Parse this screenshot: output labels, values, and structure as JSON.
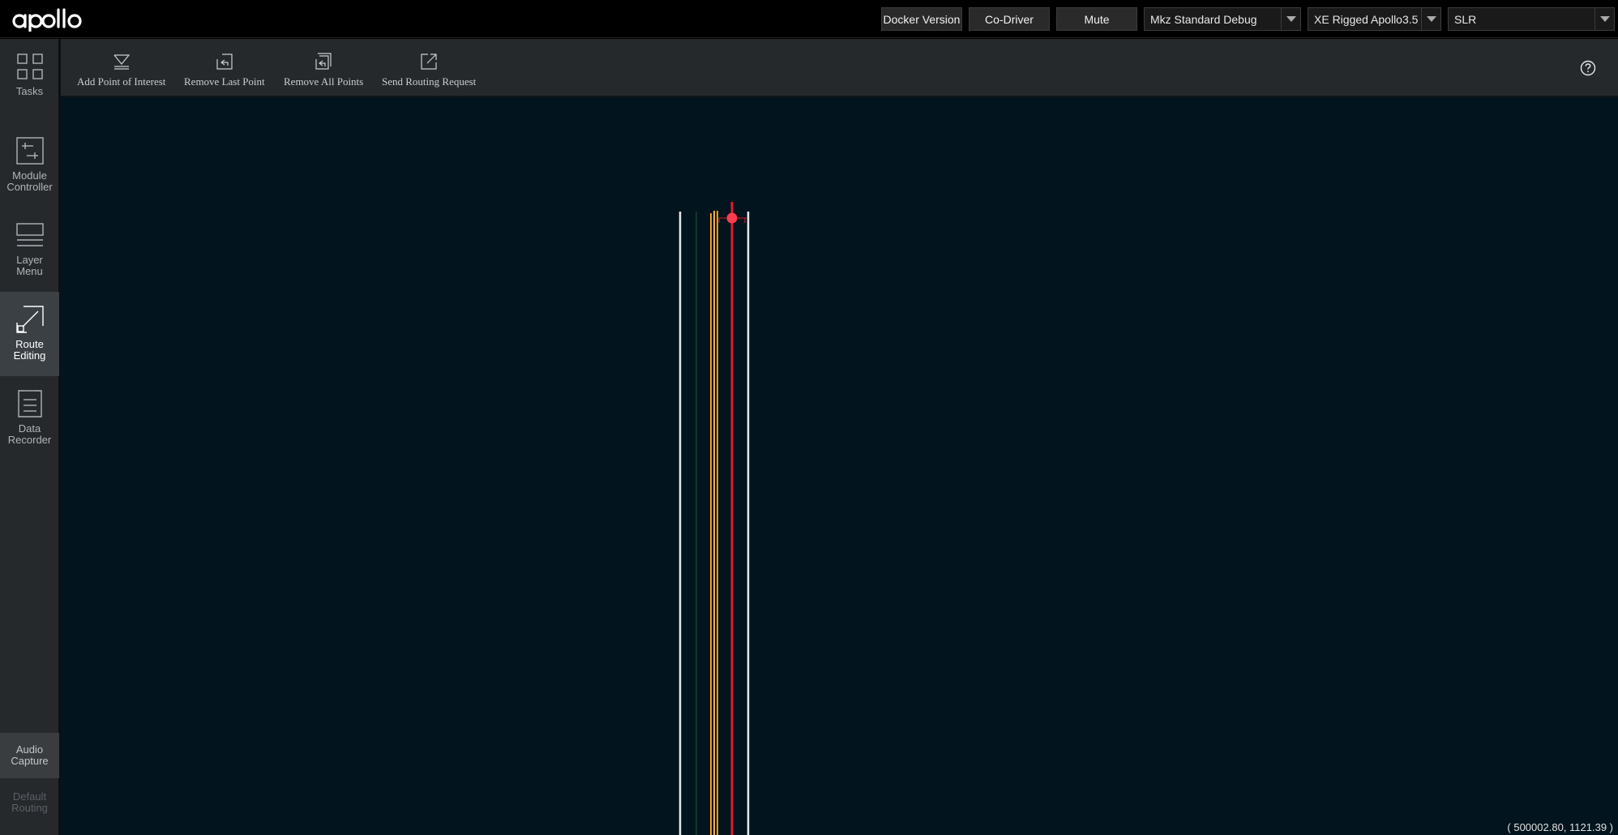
{
  "app": {
    "logo_text": "apollo"
  },
  "header": {
    "docker_button": "Docker Version",
    "codriver_button": "Co-Driver",
    "mute_button": "Mute",
    "mode_select": "Mkz Standard Debug",
    "vehicle_select": "XE Rigged Apollo3.5",
    "map_select": "SLR"
  },
  "sidebar": {
    "items": [
      {
        "label": "Tasks",
        "icon": "tasks-grid-icon"
      },
      {
        "label": "Module\nController",
        "icon": "module-controller-icon"
      },
      {
        "label": "Layer\nMenu",
        "icon": "layer-menu-icon"
      },
      {
        "label": "Route\nEditing",
        "icon": "route-editing-icon",
        "active": true
      },
      {
        "label": "Data\nRecorder",
        "icon": "data-recorder-icon"
      }
    ],
    "audio_capture": "Audio\nCapture",
    "default_routing": "Default\nRouting"
  },
  "toolbar": {
    "add_point": "Add Point of Interest",
    "remove_last": "Remove Last Point",
    "remove_all": "Remove All Points",
    "send_routing": "Send Routing Request"
  },
  "map": {
    "coordinate_readout": "( 500002.80, 1121.39 )",
    "colors": {
      "background": "#02141d",
      "lane_boundary": "#e8e8e8",
      "lane_center": "#f0a030",
      "route_line": "#e0192d",
      "marker": "#ff3c50"
    }
  }
}
